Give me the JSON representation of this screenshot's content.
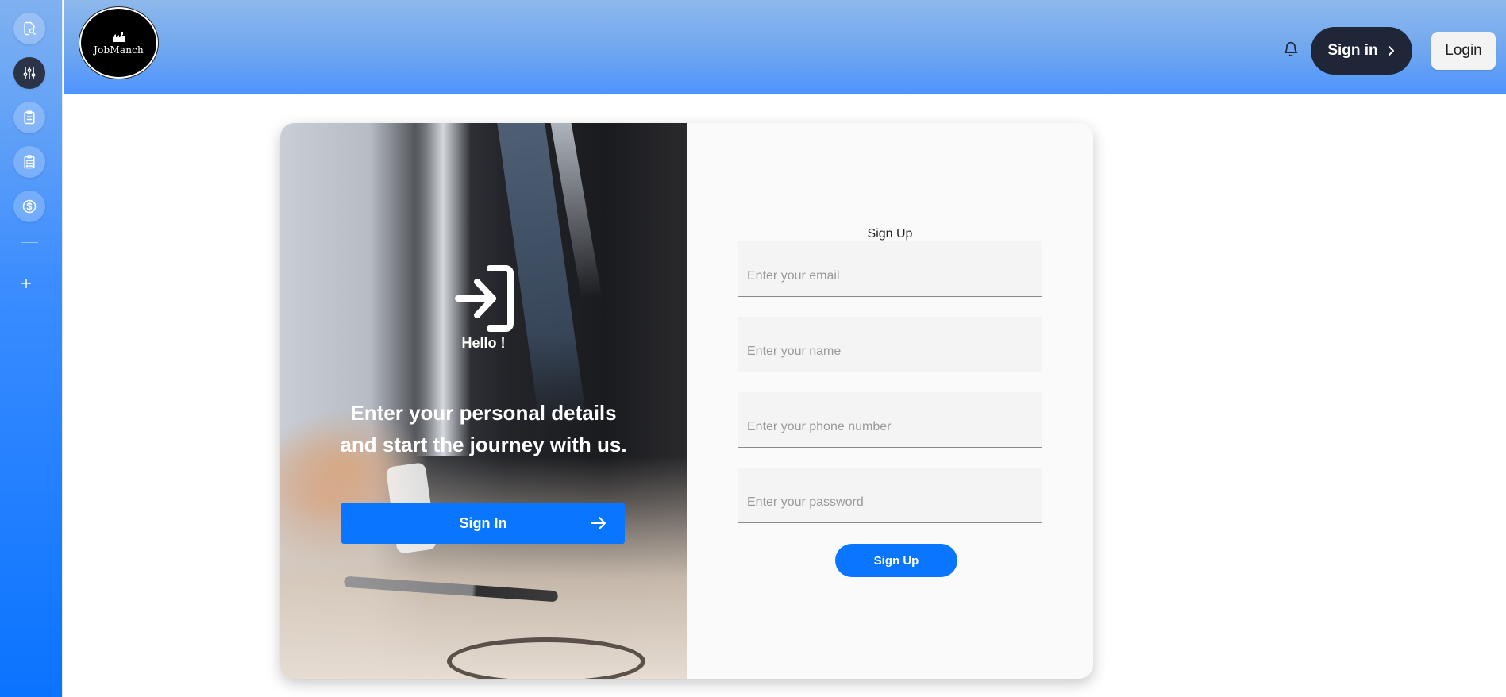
{
  "sidebar": {
    "items": [
      {
        "icon": "file-search-icon",
        "active": false
      },
      {
        "icon": "sliders-icon",
        "active": true
      },
      {
        "icon": "clipboard-icon",
        "active": false
      },
      {
        "icon": "clipboard-list-icon",
        "active": false
      },
      {
        "icon": "dollar-circle-icon",
        "active": false
      }
    ],
    "add_icon": "plus-icon"
  },
  "header": {
    "logo_text": "JobManch",
    "bell_icon": "bell-icon",
    "signin_label": "Sign in",
    "login_label": "Login"
  },
  "card": {
    "left": {
      "hello": "Hello !",
      "tagline_line1": "Enter your personal details",
      "tagline_line2": "and start the journey with us.",
      "signin_button": "Sign In"
    },
    "right": {
      "title": "Sign Up",
      "fields": [
        {
          "placeholder": "Enter your email",
          "value": ""
        },
        {
          "placeholder": "Enter your name",
          "value": ""
        },
        {
          "placeholder": "Enter your phone number",
          "value": ""
        },
        {
          "placeholder": "Enter your password",
          "value": ""
        }
      ],
      "submit": "Sign Up"
    }
  },
  "colors": {
    "primary": "#0a75ff",
    "dark": "#1f2637",
    "header_top": "#8db8ec",
    "header_bottom": "#4d94ff"
  }
}
